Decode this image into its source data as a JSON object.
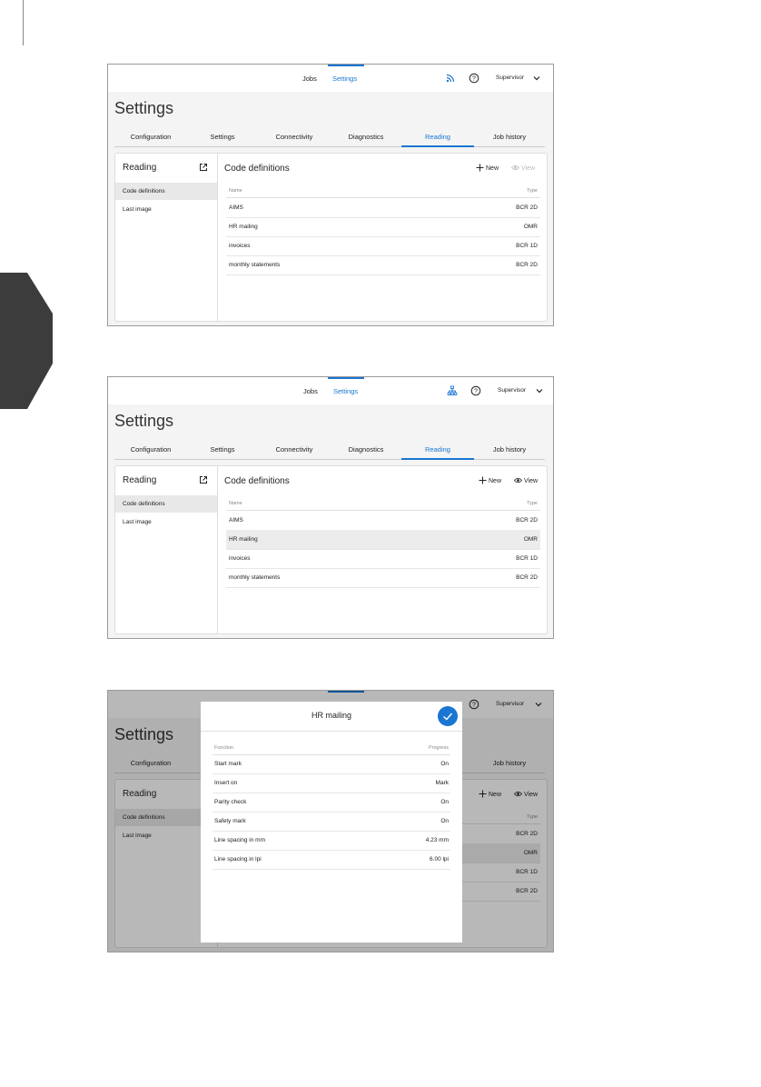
{
  "colors": {
    "accent": "#1976d2",
    "side_tab": "#3c3c3c"
  },
  "top": {
    "jobs": "Jobs",
    "settings": "Settings",
    "user": "Supervisor"
  },
  "page_title": "Settings",
  "tabs": [
    "Configuration",
    "Settings",
    "Connectivity",
    "Diagnostics",
    "Reading",
    "Job history"
  ],
  "sidebar": {
    "title": "Reading",
    "items": [
      "Code definitions",
      "Last image"
    ]
  },
  "main": {
    "title": "Code definitions",
    "new_label": "New",
    "view_label": "View",
    "col_name": "Name",
    "col_type": "Type",
    "rows": [
      {
        "name": "AIMS",
        "type": "BCR 2D"
      },
      {
        "name": "HR mailing",
        "type": "OMR"
      },
      {
        "name": "invoices",
        "type": "BCR 1D"
      },
      {
        "name": "monthly statements",
        "type": "BCR 2D"
      }
    ]
  },
  "dialog": {
    "title": "HR mailing",
    "col_function": "Function",
    "col_progress": "Progress",
    "rows": [
      {
        "function": "Start mark",
        "value": "On"
      },
      {
        "function": "Insert on",
        "value": "Mark"
      },
      {
        "function": "Parity check",
        "value": "On"
      },
      {
        "function": "Safety mark",
        "value": "On"
      },
      {
        "function": "Line spacing in mm",
        "value": "4.23 mm"
      },
      {
        "function": "Line spacing in lpi",
        "value": "6.00 lpi"
      }
    ]
  },
  "shot3_types": [
    "BCR 2D",
    "OMR",
    "BCR 1D",
    "BCR 2D"
  ]
}
